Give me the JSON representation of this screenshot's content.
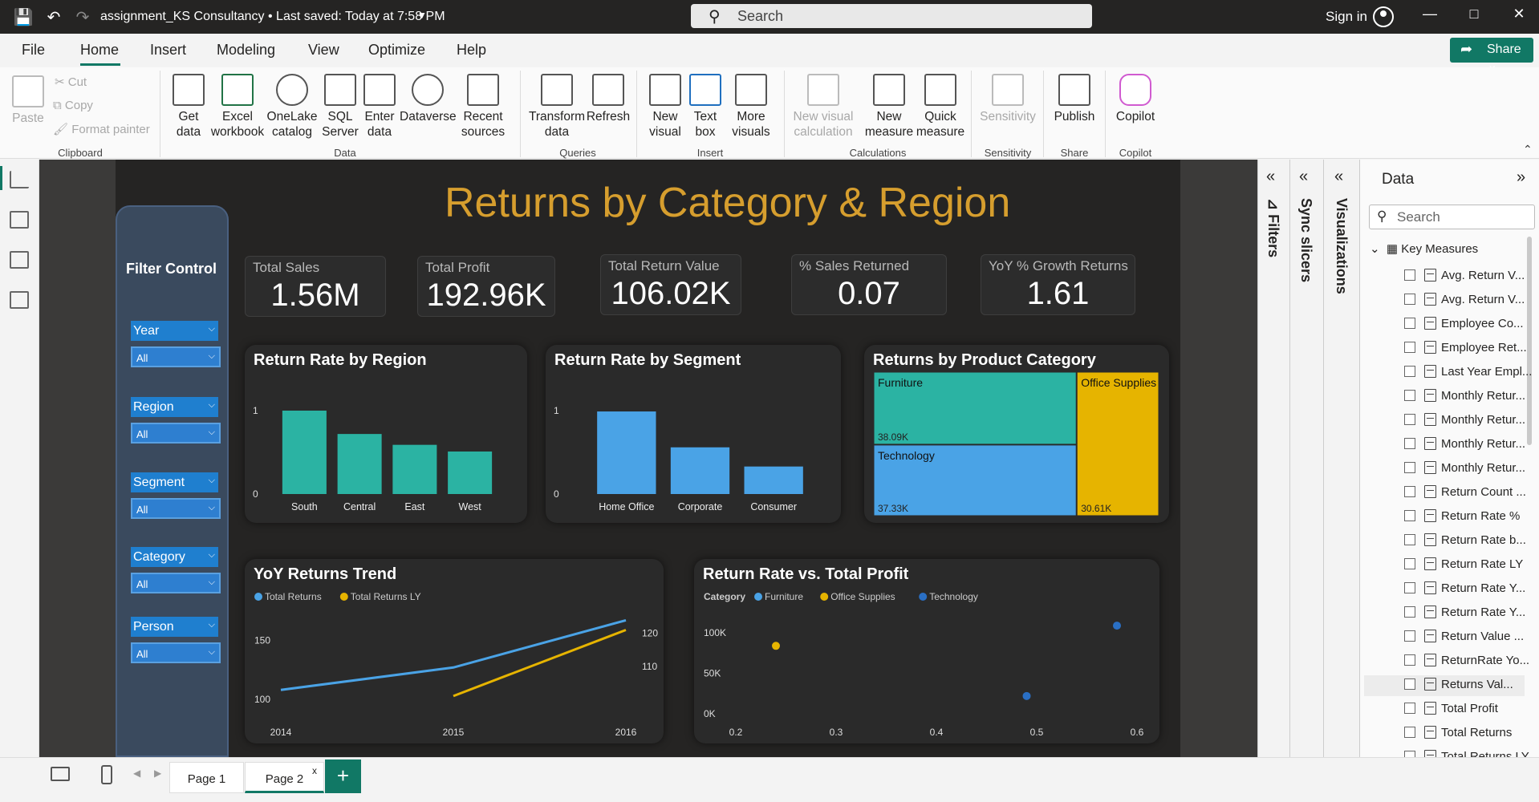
{
  "titlebar": {
    "doc_title": "assignment_KS Consultancy • Last saved: Today at 7:58 PM",
    "search_placeholder": "Search",
    "signin": "Sign in"
  },
  "menu": {
    "tabs": [
      "File",
      "Home",
      "Insert",
      "Modeling",
      "View",
      "Optimize",
      "Help"
    ],
    "active": "Home",
    "share": "Share"
  },
  "ribbon": {
    "clipboard": {
      "paste": "Paste",
      "cut": "Cut",
      "copy": "Copy",
      "format_painter": "Format painter",
      "label": "Clipboard"
    },
    "data": {
      "get_data": "Get data",
      "excel": "Excel workbook",
      "onelake": "OneLake catalog",
      "sql": "SQL Server",
      "enter": "Enter data",
      "dataverse": "Dataverse",
      "recent": "Recent sources",
      "label": "Data"
    },
    "queries": {
      "transform": "Transform data",
      "refresh": "Refresh",
      "label": "Queries"
    },
    "insert": {
      "new_visual": "New visual",
      "text_box": "Text box",
      "more_visuals": "More visuals",
      "label": "Insert"
    },
    "calculations": {
      "new_visual_calc": "New visual calculation",
      "new_measure": "New measure",
      "quick_measure": "Quick measure",
      "label": "Calculations"
    },
    "sensitivity": {
      "btn": "Sensitivity",
      "label": "Sensitivity"
    },
    "share": {
      "publish": "Publish",
      "label": "Share"
    },
    "copilot": {
      "btn": "Copilot",
      "label": "Copilot"
    }
  },
  "report": {
    "title": "Returns by Category & Region",
    "filter_title": "Filter Control",
    "slicers": [
      {
        "name": "Year",
        "value": "All"
      },
      {
        "name": "Region",
        "value": "All"
      },
      {
        "name": "Segment",
        "value": "All"
      },
      {
        "name": "Category",
        "value": "All"
      },
      {
        "name": "Person",
        "value": "All"
      }
    ],
    "kpis": [
      {
        "label": "Total Sales",
        "value": "1.56M"
      },
      {
        "label": "Total Profit",
        "value": "192.96K"
      },
      {
        "label": "Total Return Value",
        "value": "106.02K"
      },
      {
        "label": "% Sales Returned",
        "value": "0.07"
      },
      {
        "label": "YoY % Growth Returns",
        "value": "1.61"
      }
    ]
  },
  "chart_data": [
    {
      "type": "bar",
      "title": "Return Rate by Region",
      "categories": [
        "South",
        "Central",
        "East",
        "West"
      ],
      "values": [
        1.0,
        0.72,
        0.59,
        0.51
      ],
      "yticks": [
        "1",
        "0"
      ],
      "ylim": [
        0,
        1
      ],
      "color": "#2bb3a3"
    },
    {
      "type": "bar",
      "title": "Return Rate by Segment",
      "categories": [
        "Home Office",
        "Corporate",
        "Consumer"
      ],
      "values": [
        0.99,
        0.56,
        0.33
      ],
      "yticks": [
        "1",
        "0"
      ],
      "ylim": [
        0,
        1
      ],
      "color": "#4aa3e6"
    },
    {
      "type": "treemap",
      "title": "Returns by Product Category",
      "items": [
        {
          "name": "Furniture",
          "value": 38.09,
          "label": "38.09K",
          "color": "#2bb3a3"
        },
        {
          "name": "Technology",
          "value": 37.33,
          "label": "37.33K",
          "color": "#4aa3e6"
        },
        {
          "name": "Office Supplies",
          "value": 30.61,
          "label": "30.61K",
          "color": "#e6b400"
        }
      ]
    },
    {
      "type": "line",
      "title": "YoY Returns Trend",
      "x": [
        "2014",
        "2015",
        "2016"
      ],
      "series": [
        {
          "name": "Total Returns",
          "color": "#4aa3e6",
          "axis": "left",
          "values": [
            108,
            127,
            167
          ]
        },
        {
          "name": "Total Returns LY",
          "color": "#e6b400",
          "axis": "right",
          "values": [
            null,
            101,
            121
          ]
        }
      ],
      "left_ticks": [
        "150",
        "100"
      ],
      "right_ticks": [
        "120",
        "110"
      ],
      "ylim_left": [
        100,
        170
      ],
      "ylim_right": [
        100,
        125
      ]
    },
    {
      "type": "scatter",
      "title": "Return Rate vs. Total Profit",
      "legend_title": "Category",
      "series": [
        {
          "name": "Furniture",
          "color": "#4aa3e6"
        },
        {
          "name": "Office Supplies",
          "color": "#e6b400",
          "points": [
            [
              0.24,
              84000
            ]
          ]
        },
        {
          "name": "Technology",
          "color": "#2a6fc4",
          "points": [
            [
              0.49,
              22000
            ],
            [
              0.58,
              109000
            ]
          ]
        }
      ],
      "xticks": [
        "0.2",
        "0.3",
        "0.4",
        "0.5",
        "0.6"
      ],
      "yticks": [
        "100K",
        "50K",
        "0K"
      ],
      "xlim": [
        0.2,
        0.6
      ],
      "ylim": [
        0,
        120000
      ]
    }
  ],
  "panes": {
    "filters": "Filters",
    "sync": "Sync slicers",
    "viz": "Visualizations",
    "data_title": "Data",
    "data_search": "Search",
    "table": "Key Measures",
    "fields": [
      "Avg. Return V...",
      "Avg. Return V...",
      "Employee Co...",
      "Employee Ret...",
      "Last Year Empl...",
      "Monthly Retur...",
      "Monthly Retur...",
      "Monthly Retur...",
      "Monthly Retur...",
      "Return Count ...",
      "Return Rate %",
      "Return Rate b...",
      "Return Rate LY",
      "Return Rate Y...",
      "Return Rate Y...",
      "Return Value ...",
      "ReturnRate Yo...",
      "Returns Val...",
      "Total Profit",
      "Total Returns",
      "Total Returns LY",
      "Total Returns ..."
    ]
  },
  "pages": {
    "page1": "Page 1",
    "page2": "Page 2"
  }
}
